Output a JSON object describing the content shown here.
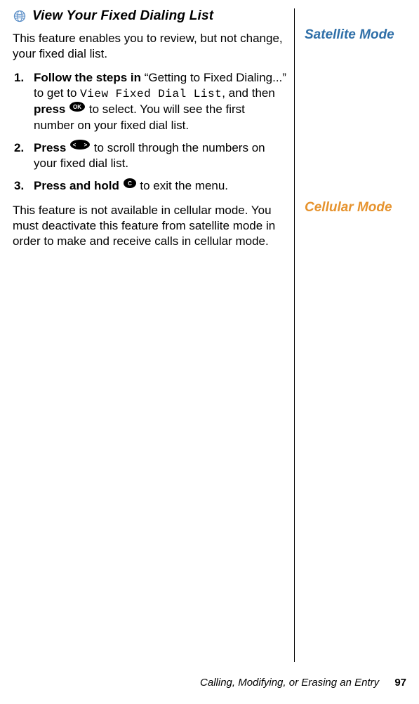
{
  "heading": "View Your Fixed Dialing List",
  "intro": "This feature enables you to review, but not change, your fixed dial list.",
  "steps": {
    "s1": {
      "lead": "Follow the steps in",
      "quote_part": "“Getting to Fixed Dialing...” to get to ",
      "lcd": "View Fixed Dial List",
      "mid": ", and then ",
      "press": "press",
      "tail": " to select. You will see the first number on your fixed dial list."
    },
    "s2": {
      "lead": "Press",
      "tail": " to scroll through the numbers on your fixed dial list."
    },
    "s3": {
      "lead": "Press and hold",
      "tail": " to exit the menu."
    }
  },
  "cellular_note": "This feature is not available in cellular mode. You must deactivate this feature from satellite mode in order to make and receive calls in cellular mode.",
  "side": {
    "satellite": "Satellite Mode",
    "cellular": "Cellular Mode"
  },
  "footer": {
    "section": "Calling, Modifying, or Erasing an Entry",
    "page": "97"
  },
  "icons": {
    "globe": "globe-icon",
    "ok": "ok-key-icon",
    "scroll": "scroll-key-icon",
    "c": "c-key-icon"
  }
}
